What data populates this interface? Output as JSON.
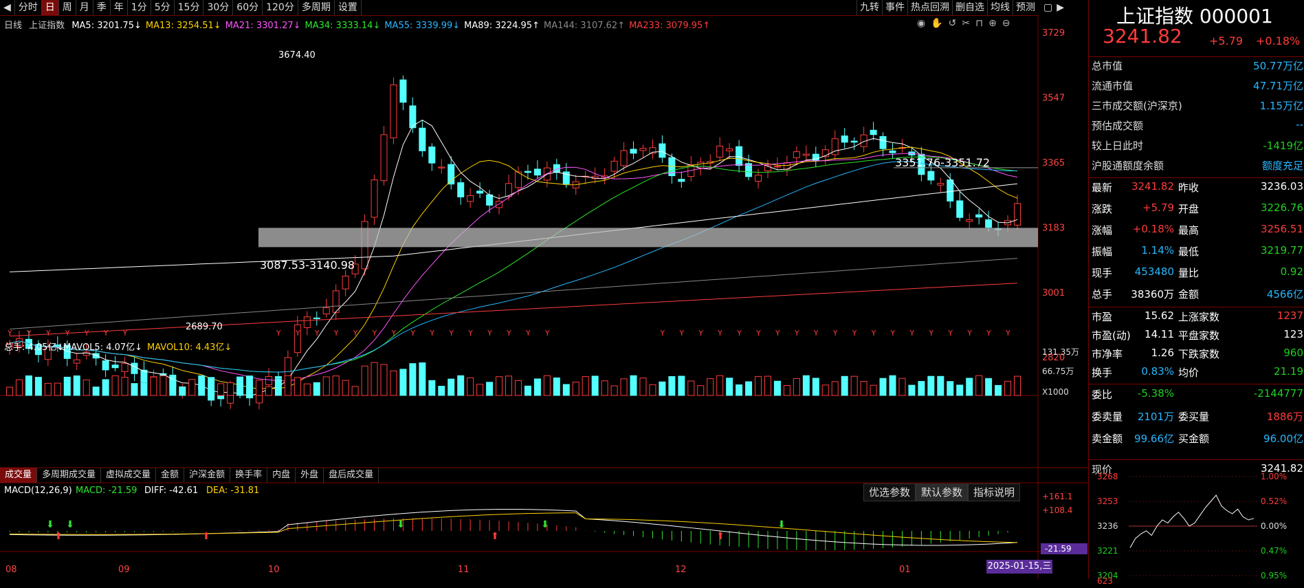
{
  "toolbar": {
    "periods": [
      "分时",
      "日",
      "周",
      "月",
      "季",
      "年",
      "1分",
      "5分",
      "15分",
      "30分",
      "60分",
      "120分",
      "多周期",
      "设置"
    ],
    "active_period": "日",
    "right_tools": [
      "九转",
      "事件",
      "热点回溯",
      "删自选",
      "均线",
      "预测"
    ]
  },
  "legend": {
    "period_label": "日线",
    "index_name": "上证指数",
    "ma": [
      {
        "label": "MA5: 3201.75↓",
        "color": "#ffffff"
      },
      {
        "label": "MA13: 3254.51↓",
        "color": "#ffd200"
      },
      {
        "label": "MA21: 3301.27↓",
        "color": "#ff55ff"
      },
      {
        "label": "MA34: 3333.14↓",
        "color": "#2ee82e"
      },
      {
        "label": "MA55: 3339.99↓",
        "color": "#29b7ff"
      },
      {
        "label": "MA89: 3224.95↑",
        "color": "#ffffff"
      },
      {
        "label": "MA144: 3107.62↑",
        "color": "#888888"
      },
      {
        "label": "MA233: 3079.95↑",
        "color": "#ff3c3c"
      }
    ]
  },
  "price_axis": [
    "3729",
    "3547",
    "3365",
    "3183",
    "3001",
    "2820"
  ],
  "annotations": {
    "high": "3674.40",
    "low": "2689.70",
    "box_range": "3087.53-3140.98",
    "resistance": "3351.76-3351.72"
  },
  "volume": {
    "legend": [
      {
        "label": "总手: 4.05亿↓",
        "color": "#ffffff"
      },
      {
        "label": "MAVOL5: 4.07亿↓",
        "color": "#ffffff"
      },
      {
        "label": "MAVOL10: 4.43亿↓",
        "color": "#ffd200"
      }
    ],
    "axis": [
      "131.35万",
      "66.75万",
      "X1000"
    ]
  },
  "bottom_tabs": [
    "成交量",
    "多周期成交量",
    "虚拟成交量",
    "金额",
    "沪深金额",
    "换手率",
    "内盘",
    "外盘",
    "盘后成交量"
  ],
  "active_bottom_tab": "成交量",
  "macd": {
    "legend": [
      {
        "label": "MACD(12,26,9)",
        "color": "#ffffff"
      },
      {
        "label": "MACD: -21.59",
        "color": "#2ee82e"
      },
      {
        "label": "DIFF: -42.61",
        "color": "#ffffff"
      },
      {
        "label": "DEA: -31.81",
        "color": "#ffd200"
      }
    ],
    "axis": [
      "+161.1",
      "+108.4",
      "-21.59"
    ],
    "param_tabs": [
      "优选参数",
      "默认参数",
      "指标说明"
    ],
    "active_param_tab": "默认参数"
  },
  "date_axis": [
    "08",
    "09",
    "10",
    "11",
    "12",
    "01"
  ],
  "date_cursor": "2025-01-15,三",
  "panel": {
    "title": "上证指数 000001",
    "price": "3241.82",
    "change": "+5.79",
    "change_pct": "+0.18%",
    "group1": [
      {
        "k": "总市值",
        "v": "50.77万亿",
        "c": "cyan"
      },
      {
        "k": "流通市值",
        "v": "47.71万亿",
        "c": "cyan"
      },
      {
        "k": "三市成交额(沪深京)",
        "v": "1.15万亿",
        "c": "cyan"
      },
      {
        "k": "预估成交额",
        "v": "--",
        "c": "cyan"
      },
      {
        "k": "较上日此时",
        "v": "-1419亿",
        "c": "green"
      },
      {
        "k": "沪股通额度余额",
        "v": "额度充足",
        "c": "cyan"
      }
    ],
    "quote": [
      {
        "k1": "最新",
        "v1": "3241.82",
        "c1": "red",
        "k2": "昨收",
        "v2": "3236.03",
        "c2": "white"
      },
      {
        "k1": "涨跌",
        "v1": "+5.79",
        "c1": "red",
        "k2": "开盘",
        "v2": "3226.76",
        "c2": "green"
      },
      {
        "k1": "涨幅",
        "v1": "+0.18%",
        "c1": "red",
        "k2": "最高",
        "v2": "3256.51",
        "c2": "red"
      },
      {
        "k1": "振幅",
        "v1": "1.14%",
        "c1": "cyan",
        "k2": "最低",
        "v2": "3219.77",
        "c2": "green"
      },
      {
        "k1": "现手",
        "v1": "453480",
        "c1": "cyan",
        "k2": "量比",
        "v2": "0.92",
        "c2": "green"
      },
      {
        "k1": "总手",
        "v1": "38360万",
        "c1": "white",
        "k2": "金额",
        "v2": "4566亿",
        "c2": "cyan"
      }
    ],
    "stats": [
      {
        "k1": "市盈",
        "v1": "15.62",
        "c1": "white",
        "k2": "上涨家数",
        "v2": "1237",
        "c2": "red"
      },
      {
        "k1": "市盈(动)",
        "v1": "14.11",
        "c1": "white",
        "k2": "平盘家数",
        "v2": "123",
        "c2": "white"
      },
      {
        "k1": "市净率",
        "v1": "1.26",
        "c1": "white",
        "k2": "下跌家数",
        "v2": "960",
        "c2": "green"
      },
      {
        "k1": "换手",
        "v1": "0.83%",
        "c1": "cyan",
        "k2": "均价",
        "v2": "21.19",
        "c2": "green"
      }
    ],
    "order": [
      {
        "k1": "委比",
        "v1": "-5.38%",
        "c1": "green",
        "k2": "",
        "v2": "-2144777",
        "c2": "green"
      },
      {
        "k1": "委卖量",
        "v1": "2101万",
        "c1": "cyan",
        "k2": "委买量",
        "v2": "1886万",
        "c2": "red"
      },
      {
        "k1": "卖金额",
        "v1": "99.66亿",
        "c1": "cyan",
        "k2": "买金额",
        "v2": "96.00亿",
        "c2": "cyan"
      }
    ],
    "minichart": {
      "left_axis": [
        "3268",
        "3253",
        "3236",
        "3221",
        "3204"
      ],
      "right_axis": [
        "1.00%",
        "0.52%",
        "0.00%",
        "0.47%",
        "0.95%"
      ],
      "partial_row": "现价",
      "vol_label": "623"
    }
  },
  "colors": {
    "up": "#ff3c3c",
    "down": "#54ffff",
    "bg": "#000000",
    "frame": "#7a0000"
  }
}
